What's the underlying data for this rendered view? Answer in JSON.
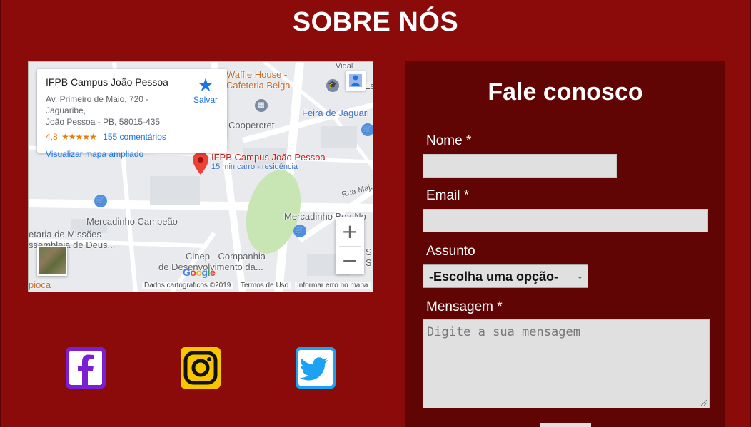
{
  "section": {
    "title": "SOBRE NÓS"
  },
  "map": {
    "info_card": {
      "title": "IFPB Campus João Pessoa",
      "address_line1": "Av. Primeiro de Maio, 720 - Jaguaribe,",
      "address_line2": "João Pessoa - PB, 58015-435",
      "rating": "4,8",
      "stars": "★★★★★",
      "reviews": "155 comentários",
      "enlarge_link": "Visualizar mapa ampliado",
      "save_label": "Salvar"
    },
    "labels": {
      "waffle_house_1": "Waffle House -",
      "waffle_house_2": "Cafeteria Belga",
      "vidal": "Vidal",
      "es": "Es",
      "feira": "Feira de Jaguari",
      "coopercret": "Coopercret",
      "ifpb": "IFPB Campus João Pessoa",
      "ifpb_sub": "15 min carro - residência",
      "rua_major": "Rua Major",
      "mercadinho_campeao": "Mercadinho Campeão",
      "mercadinho_boa": "Mercadinho Boa No",
      "missoes_1": "etaria de Missões",
      "missoes_2": "ssembleia de Deus...",
      "cinep_1": "Cinep - Companhia",
      "cinep_2": "de Desenvolvimento da...",
      "s1": "S",
      "s2": "S",
      "bioca": "pioca"
    },
    "zoom_in": "+",
    "zoom_out": "−",
    "google": "Google",
    "footer": {
      "data": "Dados cartográficos ©2019",
      "terms": "Termos de Uso",
      "report": "Informar erro no mapa"
    }
  },
  "social": {
    "facebook_color": "#7a1fd1",
    "instagram_color": "#f7c600",
    "twitter_color": "#1da1f2"
  },
  "form": {
    "title": "Fale conosco",
    "name_label": "Nome *",
    "name_value": "",
    "email_label": "Email *",
    "email_value": "",
    "subject_label": "Assunto",
    "subject_selected": "-Escolha uma opção-",
    "message_label": "Mensagem *",
    "message_placeholder": "Digite a sua mensagem"
  },
  "colors": {
    "page_bg": "#8b0a0a",
    "panel_bg": "#610404",
    "input_bg": "#e0e0e0"
  }
}
